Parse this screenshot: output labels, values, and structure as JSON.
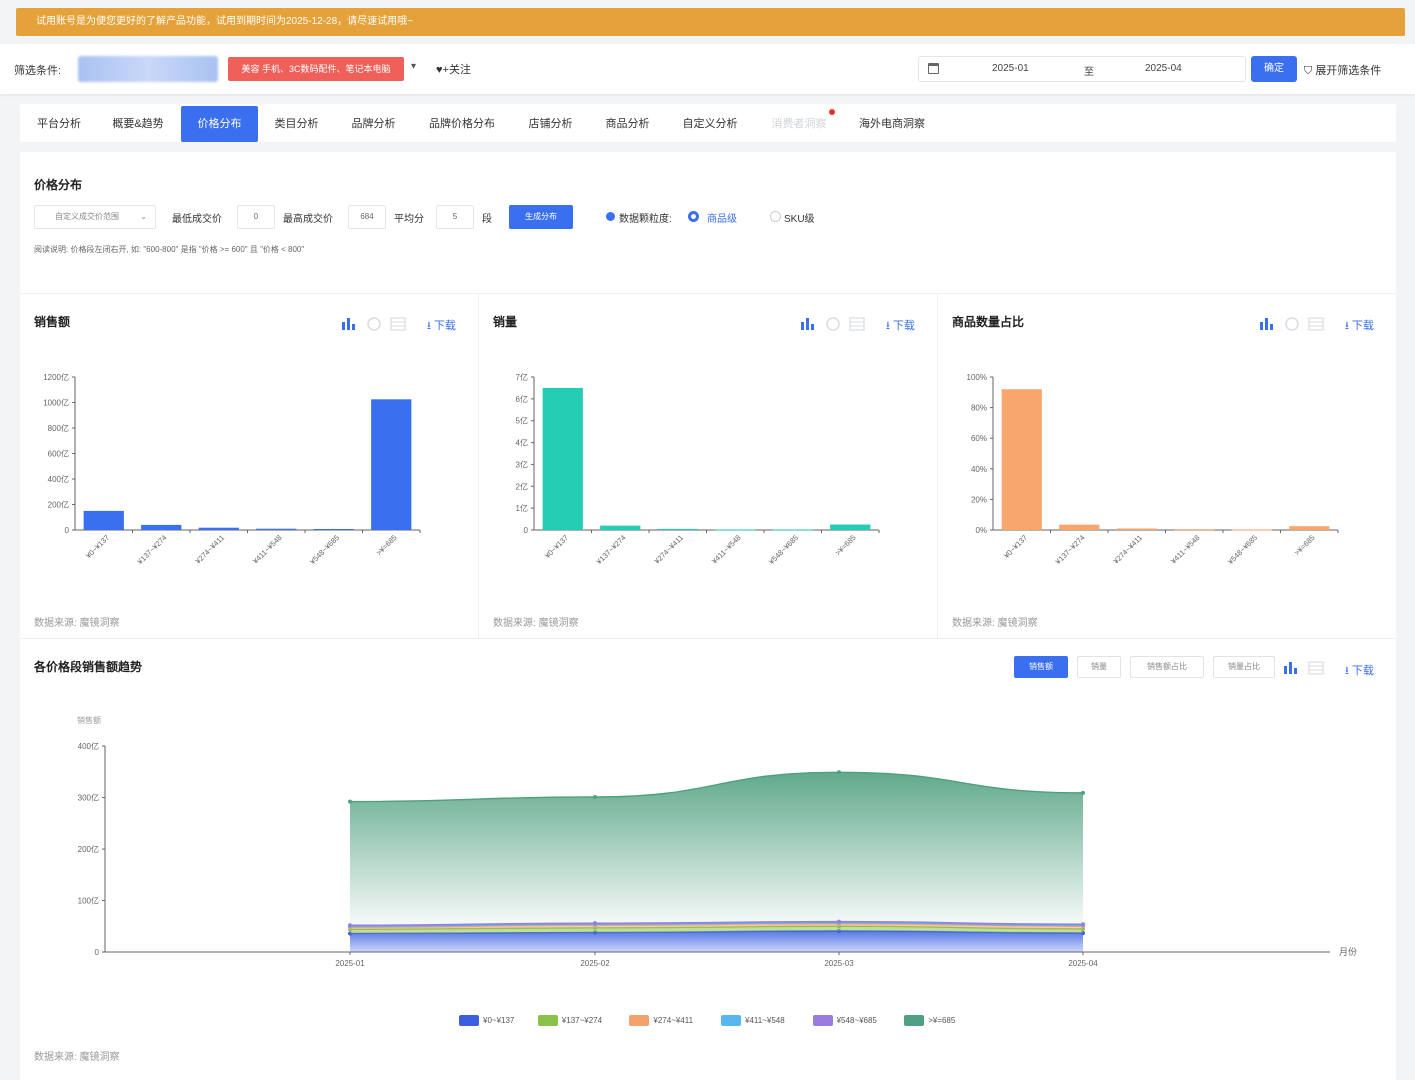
{
  "banner": {
    "text": "试用账号是为便您更好的了解产品功能，试用到期时间为2025-12-28，请尽速试用哦~"
  },
  "filter": {
    "label": "筛选条件:",
    "category_tag": "美容 手机、3C数码配件、笔记本电脑",
    "follow": "+关注",
    "date_from": "2025-01",
    "date_sep": "至",
    "date_to": "2025-04",
    "confirm": "确定",
    "expand": "展开筛选条件"
  },
  "tabs": [
    {
      "label": "平台分析",
      "state": "normal"
    },
    {
      "label": "概要&趋势",
      "state": "normal"
    },
    {
      "label": "价格分布",
      "state": "active"
    },
    {
      "label": "类目分析",
      "state": "normal"
    },
    {
      "label": "品牌分析",
      "state": "normal"
    },
    {
      "label": "品牌价格分布",
      "state": "normal"
    },
    {
      "label": "店铺分析",
      "state": "normal"
    },
    {
      "label": "商品分析",
      "state": "normal"
    },
    {
      "label": "自定义分析",
      "state": "normal"
    },
    {
      "label": "消费者洞察",
      "state": "disabled"
    },
    {
      "label": "海外电商洞察",
      "state": "normal"
    }
  ],
  "controls": {
    "title": "价格分布",
    "range_select": "自定义成交价范围",
    "min_label": "最低成交价",
    "min_value": "0",
    "max_label": "最高成交价",
    "max_value": "684",
    "split_label": "平均分",
    "split_value": "5",
    "split_unit": "段",
    "generate": "生成分布",
    "granularity_label": "数据颗粒度:",
    "option_product": "商品级",
    "option_sku": "SKU级",
    "note": "阅读说明: 价格段左闭右开, 如: \"600-800\" 是指 \"价格 >= 600\" 且 \"价格 < 800\""
  },
  "charts_meta": {
    "download": "下载",
    "source": "数据来源: 魔镜洞察"
  },
  "colors": {
    "primary": "#3a6ff0",
    "banner": "#e5a23a",
    "tag_red": "#f0605a",
    "bar_sales": "#3a6ff0",
    "bar_volume": "#25cdb5",
    "bar_share": "#f9a66c"
  },
  "chart_data": [
    {
      "type": "bar",
      "title": "销售额",
      "categories": [
        "¥0~¥137",
        "¥137~¥274",
        "¥274~¥411",
        "¥411~¥548",
        "¥548~¥685",
        ">¥=685"
      ],
      "values": [
        150,
        40,
        18,
        10,
        8,
        1025
      ],
      "yticks": [
        "0",
        "200亿",
        "400亿",
        "600亿",
        "800亿",
        "1000亿",
        "1200亿"
      ],
      "ylim": [
        0,
        1200
      ]
    },
    {
      "type": "bar",
      "title": "销量",
      "categories": [
        "¥0~¥137",
        "¥137~¥274",
        "¥274~¥411",
        "¥411~¥548",
        "¥548~¥685",
        ">¥=685"
      ],
      "values": [
        6.5,
        0.2,
        0.05,
        0.02,
        0.02,
        0.25
      ],
      "yticks": [
        "0",
        "1亿",
        "2亿",
        "3亿",
        "4亿",
        "5亿",
        "6亿",
        "7亿"
      ],
      "ylim": [
        0,
        7
      ]
    },
    {
      "type": "bar",
      "title": "商品数量占比",
      "categories": [
        "¥0~¥137",
        "¥137~¥274",
        "¥274~¥411",
        "¥411~¥548",
        "¥548~¥685",
        ">¥=685"
      ],
      "values": [
        92,
        3.5,
        1,
        0.5,
        0.3,
        2.5
      ],
      "yticks": [
        "0%",
        "20%",
        "40%",
        "60%",
        "80%",
        "100%"
      ],
      "ylim": [
        0,
        100
      ]
    },
    {
      "type": "area",
      "title": "各价格段销售额趋势",
      "ylabel": "销售额",
      "xlabel": "月份",
      "x": [
        "2025-01",
        "2025-02",
        "2025-03",
        "2025-04"
      ],
      "yticks": [
        "0",
        "100亿",
        "200亿",
        "300亿",
        "400亿"
      ],
      "ylim": [
        0,
        400
      ],
      "series": [
        {
          "name": "¥0~¥137",
          "values": [
            36,
            38,
            41,
            37
          ],
          "color": "#3a5fe0"
        },
        {
          "name": "¥137~¥274",
          "values": [
            8,
            9,
            9,
            8
          ],
          "color": "#8bc34a"
        },
        {
          "name": "¥274~¥411",
          "values": [
            4,
            5,
            5,
            5
          ],
          "color": "#f4a26b"
        },
        {
          "name": "¥411~¥548",
          "values": [
            2,
            2,
            2,
            2
          ],
          "color": "#57b8f0"
        },
        {
          "name": "¥548~¥685",
          "values": [
            2,
            2,
            2,
            2
          ],
          "color": "#9a7ce0"
        },
        {
          "name": ">¥=685",
          "values": [
            240,
            245,
            290,
            255
          ],
          "color": "#4ea07f"
        }
      ],
      "toggles": [
        {
          "label": "销售额",
          "active": true
        },
        {
          "label": "销量",
          "active": false
        },
        {
          "label": "销售额占比",
          "active": false
        },
        {
          "label": "销量占比",
          "active": false
        }
      ]
    }
  ]
}
